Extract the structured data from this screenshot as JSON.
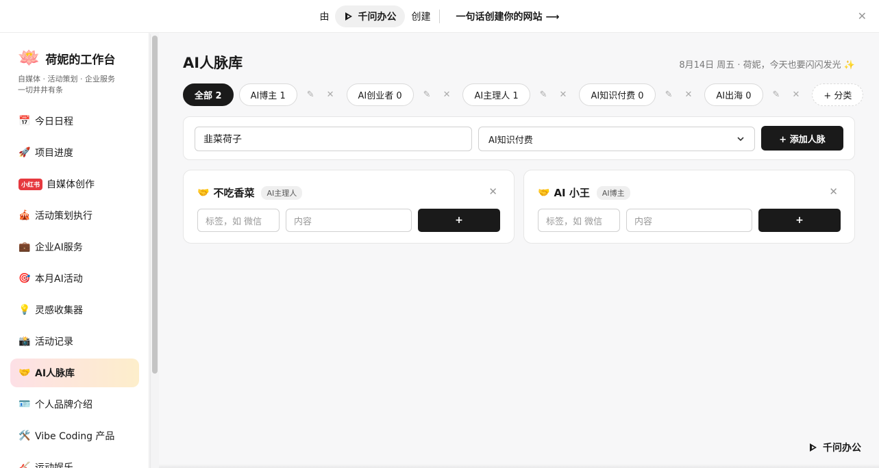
{
  "banner": {
    "by": "由",
    "brand": "千问办公",
    "create": "创建",
    "cta": "一句话创建你的网站 ⟶",
    "close": "✕"
  },
  "sidebar": {
    "logo_emoji": "🪷",
    "title": "荷妮的工作台",
    "subtitle_line1": "自媒体 · 活动策划 · 企业服务",
    "subtitle_line2": "一切井井有条",
    "items": [
      {
        "icon": "📅",
        "label": "今日日程"
      },
      {
        "icon": "🚀",
        "label": "项目进度"
      },
      {
        "badge": "小红书",
        "label": "自媒体创作"
      },
      {
        "icon": "🎪",
        "label": "活动策划执行"
      },
      {
        "icon": "💼",
        "label": "企业AI服务"
      },
      {
        "icon": "🎯",
        "label": "本月AI活动"
      },
      {
        "icon": "💡",
        "label": "灵感收集器"
      },
      {
        "icon": "📸",
        "label": "活动记录"
      },
      {
        "icon": "🤝",
        "label": "AI人脉库"
      },
      {
        "icon": "🪪",
        "label": "个人品牌介绍"
      },
      {
        "icon": "🛠️",
        "label": "Vibe Coding 产品"
      },
      {
        "icon": "🎸",
        "label": "运动娱乐"
      }
    ],
    "active_index": 8
  },
  "main": {
    "title": "AI人脉库",
    "greeting": "8月14日 周五 · 荷妮，今天也要闪闪发光 ✨",
    "tabs": [
      {
        "label": "全部 2",
        "active": true
      },
      {
        "label": "AI博主 1"
      },
      {
        "label": "AI创业者 0"
      },
      {
        "label": "AI主理人 1"
      },
      {
        "label": "AI知识付费 0"
      },
      {
        "label": "AI出海 0"
      }
    ],
    "tab_edit_icon": "✎",
    "tab_delete_icon": "✕",
    "add_category": "+ 分类",
    "form": {
      "name_value": "韭菜荷子",
      "category_value": "AI知识付费",
      "add_button": "+ 添加人脉"
    },
    "contacts": [
      {
        "emoji": "🤝",
        "name": "不吃香菜",
        "tag": "AI主理人",
        "label_placeholder": "标签，如 微信",
        "content_placeholder": "内容",
        "add": "+"
      },
      {
        "emoji": "🤝",
        "name": "AI 小王",
        "tag": "AI博主",
        "label_placeholder": "标签，如 微信",
        "content_placeholder": "内容",
        "add": "+"
      }
    ],
    "footer_brand": "千问办公"
  }
}
